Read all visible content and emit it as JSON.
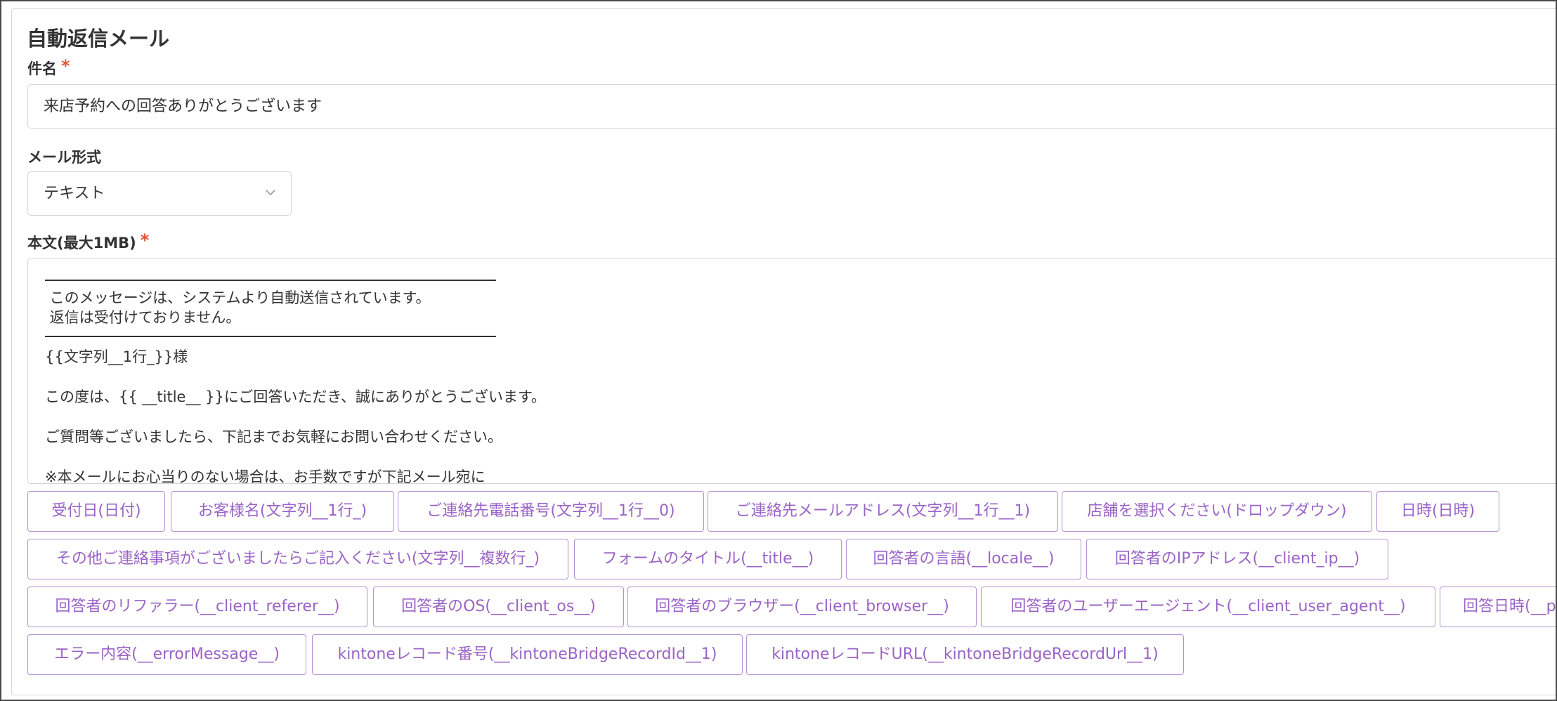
{
  "section_title": "自動返信メール",
  "subject": {
    "label": "件名",
    "required_mark": "*",
    "value": "来店予約への回答ありがとうございます"
  },
  "mail_format": {
    "label": "メール形式",
    "selected": "テキスト"
  },
  "body": {
    "label": "本文(最大1MB)",
    "required_mark": "*",
    "lines": [
      " このメッセージは、システムより自動送信されています。",
      " 返信は受付けておりません。",
      "{{文字列__1行_}}様",
      "この度は、{{ __title__ }}にご回答いただき、誠にありがとうございます。",
      "ご質問等ございましたら、下記までお気軽にお問い合わせください。",
      "※本メールにお心当りのない場合は、お手数ですが下記メール宛に"
    ]
  },
  "placeholder_chips": {
    "row1": [
      "受付日(日付)",
      "お客様名(文字列__1行_)",
      "ご連絡先電話番号(文字列__1行__0)",
      "ご連絡先メールアドレス(文字列__1行__1)",
      "店舗を選択ください(ドロップダウン)",
      "日時(日時)"
    ],
    "row2": [
      "その他ご連絡事項がございましたらご記入ください(文字列__複数行_)",
      "フォームのタイトル(__title__)",
      "回答者の言語(__locale__)",
      "回答者のIPアドレス(__client_ip__)"
    ],
    "row3": [
      "回答者のリファラー(__client_referer__)",
      "回答者のOS(__client_os__)",
      "回答者のブラウザー(__client_browser__)",
      "回答者のユーザーエージェント(__client_user_agent__)",
      "回答日時(__p"
    ],
    "row4": [
      "エラー内容(__errorMessage__)",
      "kintoneレコード番号(__kintoneBridgeRecordId__1)",
      "kintoneレコードURL(__kintoneBridgeRecordUrl__1)"
    ]
  },
  "colors": {
    "chip_border": "#b48fd4",
    "chip_text": "#9a63c7",
    "required": "#e5533c"
  }
}
